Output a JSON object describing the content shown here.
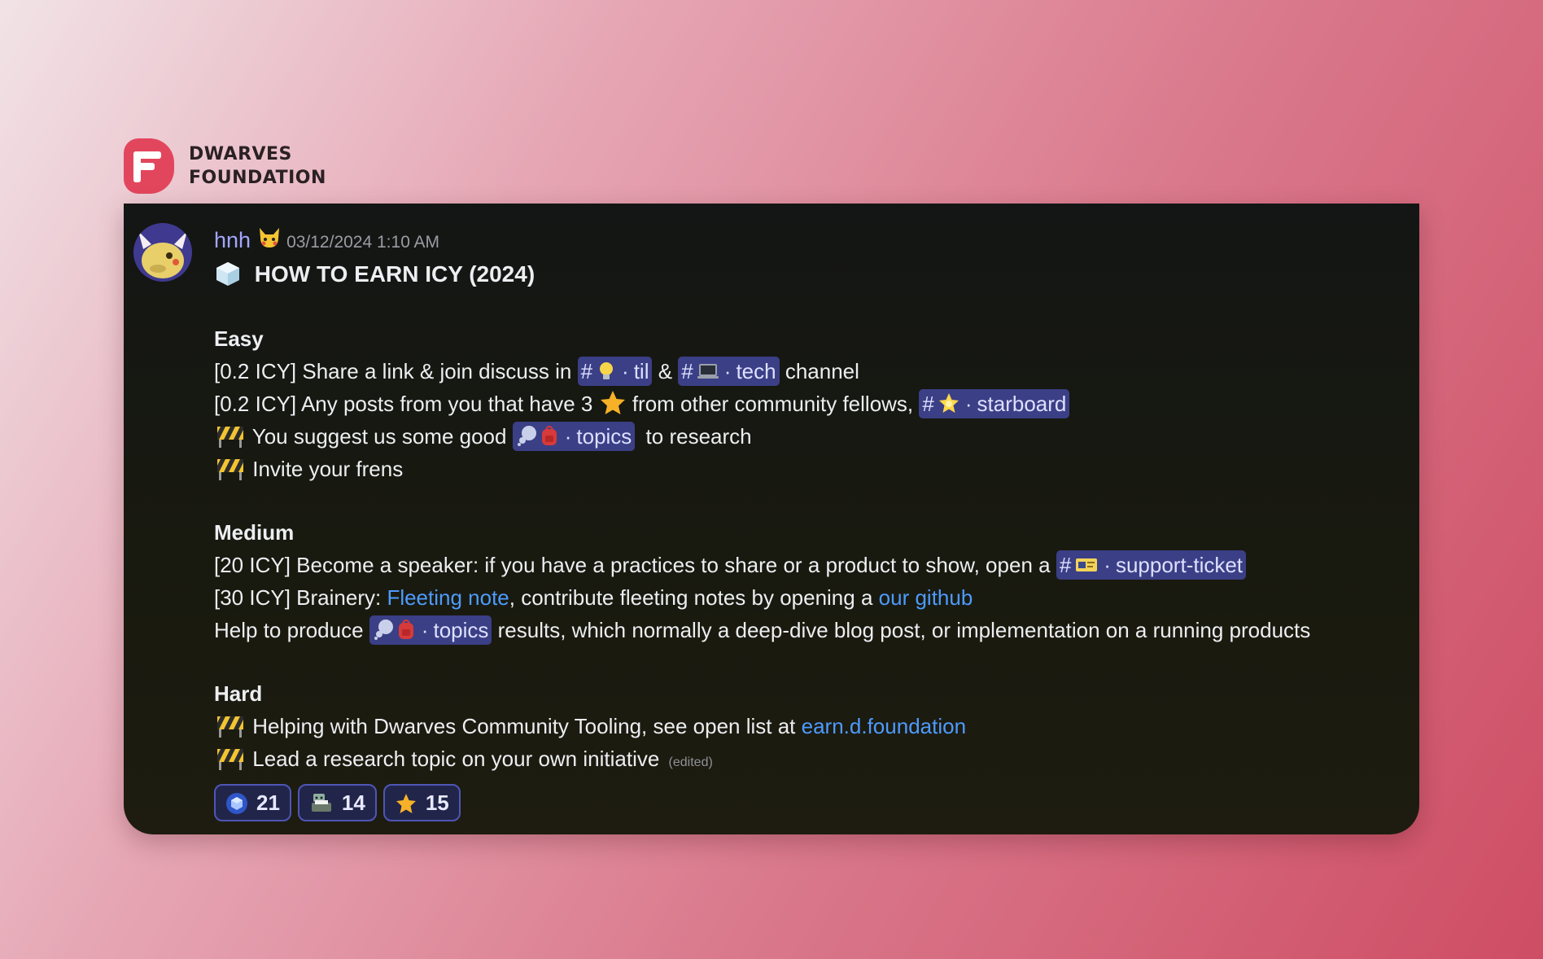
{
  "brand": {
    "name_line1": "DWARVES",
    "name_line2": "FOUNDATION",
    "logo_color": "#e2465d"
  },
  "message": {
    "username": "hnh",
    "username_color": "#a3a6ff",
    "badge_icon": "pikachu-badge-icon",
    "timestamp": "03/12/2024 1:10 AM",
    "title_icon": "ice-cube-icon",
    "title": "HOW TO EARN ICY (2024)",
    "easy": {
      "heading": "Easy",
      "line1": {
        "prefix": "[0.2 ICY] Share a link & join discuss in",
        "channel1_icon": "lightbulb-icon",
        "channel1": "til",
        "amp": "&",
        "channel2_icon": "laptop-icon",
        "channel2": "tech",
        "suffix": "channel"
      },
      "line2": {
        "prefix": "[0.2 ICY] Any posts from you that have 3",
        "star_icon": "star-icon",
        "middle": "from other community fellows,",
        "channel_icon": "glowing-star-icon",
        "channel": "starboard"
      },
      "line3": {
        "icon": "construction-icon",
        "prefix": "You suggest us some good",
        "channel_icons": [
          "thought-bubble-icon",
          "backpack-icon"
        ],
        "channel": "topics",
        "suffix": "to research"
      },
      "line4": {
        "icon": "construction-icon",
        "text": "Invite your frens"
      }
    },
    "medium": {
      "heading": "Medium",
      "line1": {
        "prefix": "[20 ICY] Become a speaker: if you have a practices to share or a product to show, open a",
        "channel_icon": "ticket-icon",
        "channel": "support-ticket"
      },
      "line2": {
        "prefix": "[30 ICY] Brainery:",
        "link1": "Fleeting note",
        "middle": ", contribute fleeting notes by opening a",
        "link2": "our github"
      },
      "line3": {
        "prefix": "Help to produce",
        "channel": "topics",
        "suffix": "results, which normally a deep-dive blog post, or implementation on a running products"
      }
    },
    "hard": {
      "heading": "Hard",
      "line1": {
        "icon": "construction-icon",
        "prefix": "Helping with Dwarves Community Tooling, see open list at",
        "link": "earn.d.foundation"
      },
      "line2": {
        "icon": "construction-icon",
        "text": "Lead a research topic on your own initiative",
        "edited": "(edited)"
      }
    },
    "reactions": [
      {
        "icon": "blue-cube-icon",
        "count": "21"
      },
      {
        "icon": "robot-printer-icon",
        "count": "14"
      },
      {
        "icon": "star-icon",
        "count": "15"
      }
    ],
    "mention_color": "#3b3f86",
    "link_color": "#4d9bff"
  }
}
